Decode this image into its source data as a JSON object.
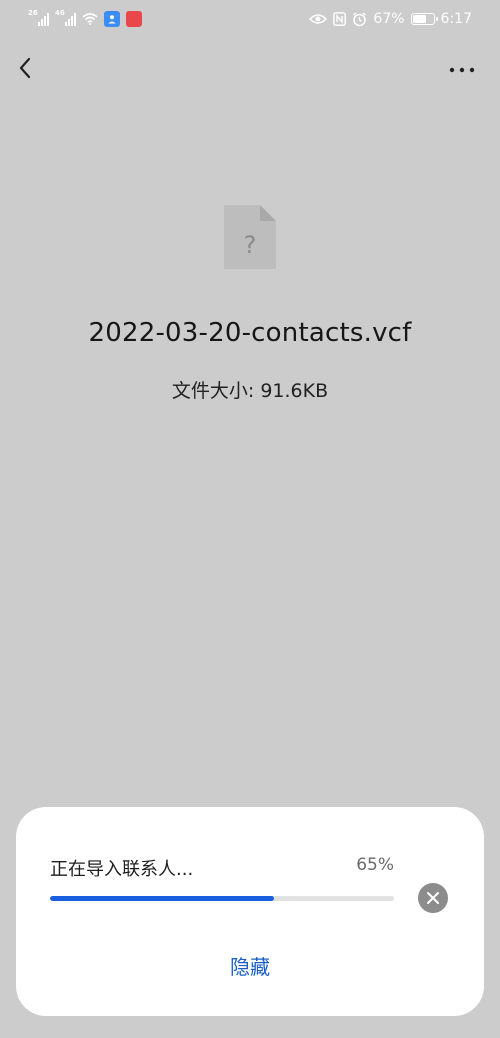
{
  "status_bar": {
    "sim1_tag": "26",
    "sim2_tag": "46",
    "battery_percent": "67%",
    "time": "6:17",
    "battery_level": 0.67,
    "icons": [
      "signal-icon",
      "wifi-icon",
      "contacts-app-icon",
      "red-app-icon",
      "eye-icon",
      "nfc-icon",
      "alarm-icon",
      "battery-icon"
    ]
  },
  "nav": {
    "back_icon": "chevron-left-icon",
    "more_icon": "more-dots-icon"
  },
  "file": {
    "icon": "unknown-file-icon",
    "icon_glyph": "?",
    "name": "2022-03-20-contacts.vcf",
    "size_text": "文件大小: 91.6KB"
  },
  "import_sheet": {
    "status_text": "正在导入联系人...",
    "percent_label": "65%",
    "progress": 0.65,
    "hide_label": "隐藏",
    "accent_color": "#1a5fe0",
    "cancel_icon": "close-circle-icon"
  }
}
